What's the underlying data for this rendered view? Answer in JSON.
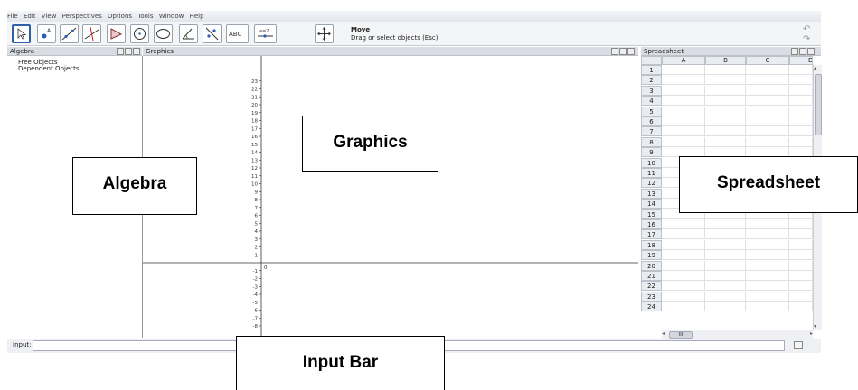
{
  "menu": [
    "File",
    "Edit",
    "View",
    "Perspectives",
    "Options",
    "Tools",
    "Window",
    "Help"
  ],
  "toolbar": {
    "tools": [
      "move",
      "point",
      "line",
      "perpendicular",
      "polygon",
      "circle",
      "conic",
      "angle",
      "reflect",
      "text",
      "slider",
      "move-view"
    ],
    "text_tool_label": "ABC",
    "slider_label": "a=2",
    "active_title": "Move",
    "active_desc": "Drag or select objects (Esc)"
  },
  "views": {
    "algebra": {
      "title": "Algebra",
      "items": [
        "Free Objects",
        "Dependent Objects"
      ]
    },
    "graphics": {
      "title": "Graphics",
      "origin_label": "0",
      "y_ticks_pos": [
        "23",
        "22",
        "21",
        "20",
        "19",
        "18",
        "17",
        "16",
        "15",
        "14",
        "13",
        "12",
        "11",
        "10",
        "9",
        "8",
        "7",
        "6",
        "5",
        "4",
        "3",
        "2",
        "1"
      ],
      "y_ticks_neg": [
        "-1",
        "-2",
        "-3",
        "-4",
        "-5",
        "-6",
        "-7",
        "-8"
      ]
    },
    "spreadsheet": {
      "title": "Spreadsheet",
      "columns": [
        "A",
        "B",
        "C",
        "D"
      ],
      "rows": [
        "1",
        "2",
        "3",
        "4",
        "5",
        "6",
        "7",
        "8",
        "9",
        "10",
        "11",
        "12",
        "13",
        "14",
        "15",
        "16",
        "17",
        "18",
        "19",
        "20",
        "21",
        "22",
        "23",
        "24"
      ],
      "hscroll_label": "III"
    }
  },
  "input_bar": {
    "label": "Input:",
    "value": ""
  },
  "callouts": {
    "graphics": "Graphics",
    "algebra": "Algebra",
    "spreadsheet": "Spreadsheet",
    "input_bar": "Input Bar"
  }
}
